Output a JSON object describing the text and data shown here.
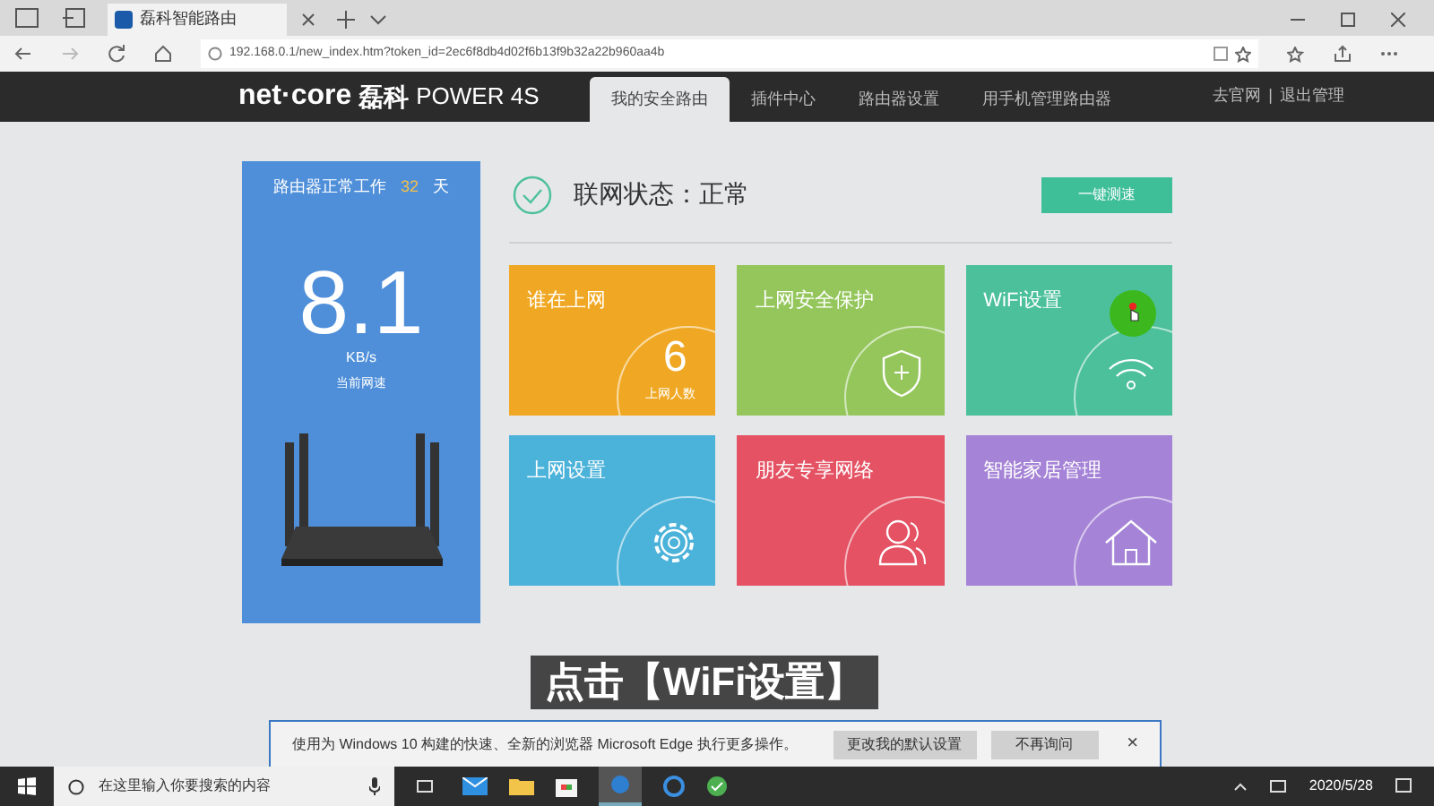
{
  "browser": {
    "tab_title": "磊科智能路由",
    "url": "192.168.0.1/new_index.htm?token_id=2ec6f8db4d02f6b13f9b32a22b960aa4b"
  },
  "header": {
    "brand": "net·core",
    "brand_cn": "磊科",
    "model": "POWER 4S",
    "tabs": [
      {
        "label": "我的安全路由",
        "selected": true
      },
      {
        "label": "插件中心",
        "selected": false
      },
      {
        "label": "路由器设置",
        "selected": false
      },
      {
        "label": "用手机管理路由器",
        "selected": false
      }
    ],
    "links": [
      "去官网",
      "退出管理"
    ],
    "separator": "|"
  },
  "router_card": {
    "uptime_label": "路由器正常工作",
    "uptime_days": "32",
    "uptime_unit": "天",
    "speed": "8.1",
    "speed_unit": "KB/s",
    "speed_label": "当前网速"
  },
  "status": {
    "text": "联网状态：正常",
    "button": "一键测速"
  },
  "tiles": [
    {
      "title": "谁在上网",
      "kind": "count",
      "count": "6",
      "count_label": "上网人数",
      "color": "#f0a824",
      "clicked": false
    },
    {
      "title": "上网安全保护",
      "kind": "shield",
      "color": "#94c65c",
      "clicked": false
    },
    {
      "title": "WiFi设置",
      "kind": "wifi",
      "color": "#4cc09b",
      "clicked": true
    },
    {
      "title": "上网设置",
      "kind": "gear",
      "color": "#4bb2d9",
      "clicked": false
    },
    {
      "title": "朋友专享网络",
      "kind": "users",
      "color": "#e45263",
      "clicked": false
    },
    {
      "title": "智能家居管理",
      "kind": "home",
      "color": "#a583d6",
      "clicked": false
    }
  ],
  "caption": "点击【WiFi设置】",
  "notification": {
    "text": "使用为 Windows 10 构建的快速、全新的浏览器 Microsoft Edge 执行更多操作。",
    "buttons": [
      "更改我的默认设置",
      "不再询问"
    ],
    "close": "×"
  },
  "taskbar": {
    "search_placeholder": "在这里输入你要搜索的内容",
    "date": "2020/5/28"
  }
}
